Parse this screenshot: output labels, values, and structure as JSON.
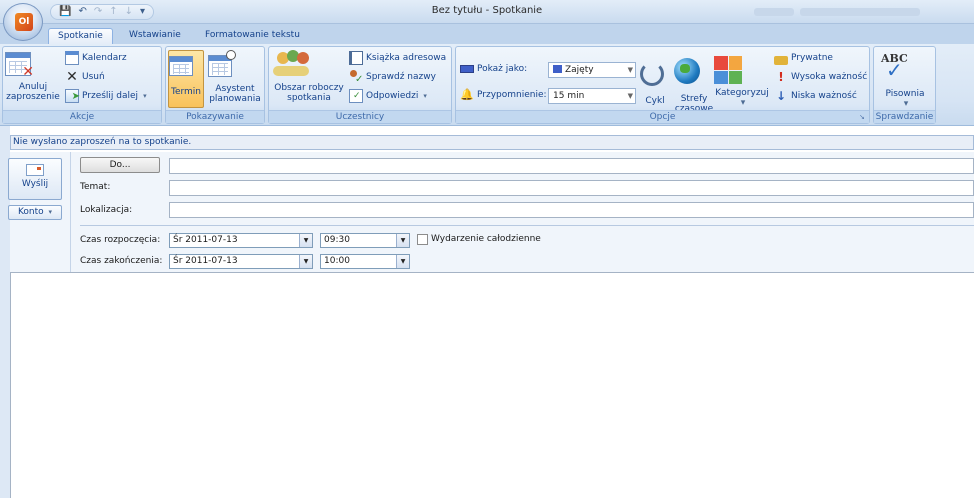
{
  "window": {
    "title": "Bez tytułu - Spotkanie",
    "app_logo_letters": "Ol"
  },
  "qat": {
    "items": [
      "save-icon",
      "undo-icon",
      "redo-icon",
      "up-icon",
      "down-icon",
      "customize-icon"
    ]
  },
  "tabs": [
    {
      "label": "Spotkanie",
      "active": true
    },
    {
      "label": "Wstawianie",
      "active": false
    },
    {
      "label": "Formatowanie tekstu",
      "active": false
    }
  ],
  "ribbon": {
    "akcje": {
      "label": "Akcje",
      "anuluj_line1": "Anuluj",
      "anuluj_line2": "zaproszenie",
      "kalendarz": "Kalendarz",
      "usun": "Usuń",
      "przeslij": "Prześlij dalej"
    },
    "pokazywanie": {
      "label": "Pokazywanie",
      "termin": "Termin",
      "asystent_line1": "Asystent",
      "asystent_line2": "planowania"
    },
    "uczestnicy": {
      "label": "Uczestnicy",
      "obszar_line1": "Obszar roboczy",
      "obszar_line2": "spotkania",
      "ksiazka": "Książka adresowa",
      "sprawdz": "Sprawdź nazwy",
      "odpowiedzi": "Odpowiedzi"
    },
    "opcje": {
      "label": "Opcje",
      "pokaz_jako": "Pokaż jako:",
      "pokaz_value": "Zajęty",
      "przypomnienie": "Przypomnienie:",
      "przypomnienie_value": "15 min",
      "cykl": "Cykl",
      "strefy_line1": "Strefy",
      "strefy_line2": "czasowe",
      "kategoryzuj": "Kategoryzuj",
      "prywatne": "Prywatne",
      "wysoka": "Wysoka ważność",
      "niska": "Niska ważność"
    },
    "sprawdzanie": {
      "label": "Sprawdzanie",
      "pisownia": "Pisownia",
      "abc": "ABC"
    }
  },
  "infobar": {
    "text": "Nie wysłano zaproszeń na to spotkanie."
  },
  "form": {
    "send": "Wyślij",
    "konto": "Konto",
    "do_button": "Do...",
    "temat_label": "Temat:",
    "lokalizacja_label": "Lokalizacja:",
    "start_label": "Czas rozpoczęcia:",
    "end_label": "Czas zakończenia:",
    "start_date": "Śr 2011-07-13",
    "start_time": "09:30",
    "end_date": "Śr 2011-07-13",
    "end_time": "10:00",
    "allday_label": "Wydarzenie całodzienne",
    "allday_checked": false,
    "to_value": "",
    "subject_value": "",
    "location_value": ""
  },
  "colors": {
    "accent": "#15428b",
    "ribbon_bg": "#dce8f6",
    "pressed": "#f9c25b",
    "busy": "#3f5fc8"
  }
}
